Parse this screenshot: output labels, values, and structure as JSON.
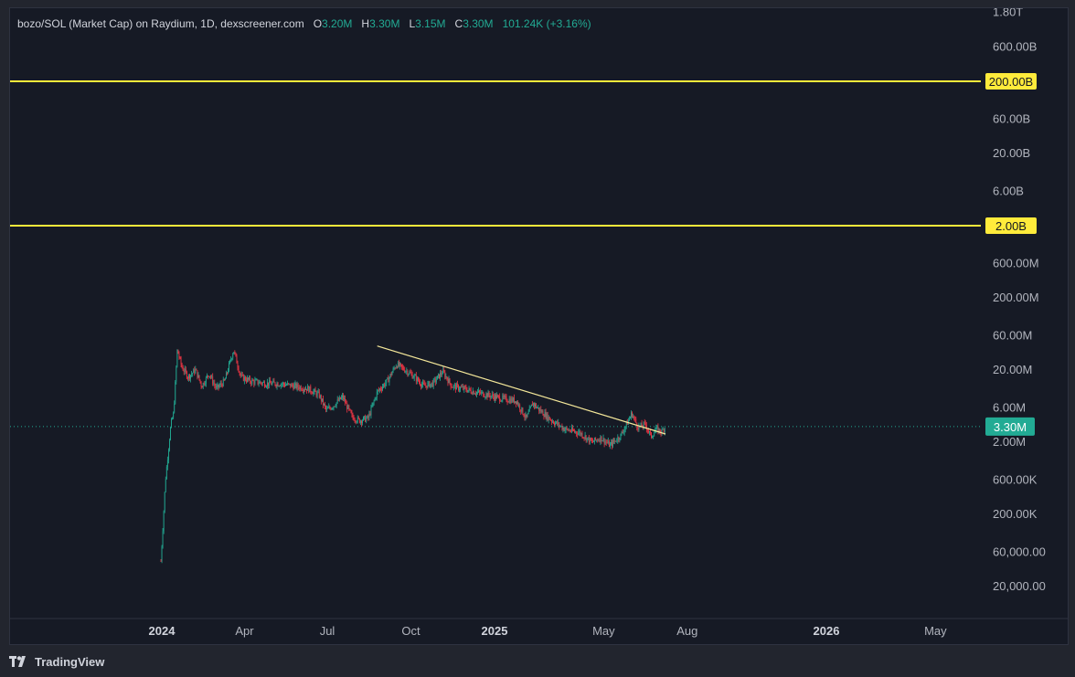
{
  "legend": {
    "title": "bozo/SOL (Market Cap) on Raydium, 1D, dexscreener.com",
    "o_label": "O",
    "o_value": "3.20M",
    "h_label": "H",
    "h_value": "3.30M",
    "l_label": "L",
    "l_value": "3.15M",
    "c_label": "C",
    "c_value": "3.30M",
    "change": "101.24K (+3.16%)"
  },
  "footer": {
    "brand": "TradingView",
    "logo_icon": "tradingview-logo-icon"
  },
  "colors": {
    "background": "#161a25",
    "up": "#22ab94",
    "down": "#f23645",
    "level_line": "#ffeb3b",
    "trendline": "#f5e89a",
    "axis_text": "#b2b5be"
  },
  "chart_data": {
    "type": "candlestick",
    "y_scale": "log",
    "y_ticks": [
      "1.80T",
      "600.00B",
      "60.00B",
      "20.00B",
      "6.00B",
      "600.00M",
      "200.00M",
      "60.00M",
      "20.00M",
      "6.00M",
      "2.00M",
      "600.00K",
      "200.00K",
      "60,000.00",
      "20,000.00"
    ],
    "y_tick_values": [
      1800000000000.0,
      600000000000.0,
      60000000000.0,
      20000000000.0,
      6000000000.0,
      600000000.0,
      200000000.0,
      60000000.0,
      20000000.0,
      6000000.0,
      2000000.0,
      600000.0,
      200000.0,
      60000.0,
      20000.0
    ],
    "x_ticks": [
      {
        "label": "2024",
        "date": "2024-01-01",
        "bold": true
      },
      {
        "label": "Apr",
        "date": "2024-04-01",
        "bold": false
      },
      {
        "label": "Jul",
        "date": "2024-07-01",
        "bold": false
      },
      {
        "label": "Oct",
        "date": "2024-10-01",
        "bold": false
      },
      {
        "label": "2025",
        "date": "2025-01-01",
        "bold": true
      },
      {
        "label": "May",
        "date": "2025-05-01",
        "bold": false
      },
      {
        "label": "Aug",
        "date": "2025-08-01",
        "bold": false
      },
      {
        "label": "2026",
        "date": "2026-01-01",
        "bold": true
      },
      {
        "label": "May",
        "date": "2026-05-01",
        "bold": false
      }
    ],
    "horizontal_levels": [
      {
        "value": 200000000000.0,
        "label": "200.00B"
      },
      {
        "value": 2000000000.0,
        "label": "2.00B"
      }
    ],
    "current_price": {
      "value": 3300000.0,
      "label": "3.30M"
    },
    "trendline": [
      {
        "date": "2024-08-25",
        "value": 43000000.0
      },
      {
        "date": "2025-07-08",
        "value": 2600000.0
      }
    ],
    "close_path": [
      [
        "2023-12-31",
        45000.0
      ],
      [
        "2024-01-02",
        120000.0
      ],
      [
        "2024-01-05",
        600000.0
      ],
      [
        "2024-01-08",
        1500000.0
      ],
      [
        "2024-01-11",
        3500000.0
      ],
      [
        "2024-01-14",
        5000000.0
      ],
      [
        "2024-01-18",
        38000000.0
      ],
      [
        "2024-01-23",
        22000000.0
      ],
      [
        "2024-01-30",
        16000000.0
      ],
      [
        "2024-02-07",
        20000000.0
      ],
      [
        "2024-02-14",
        12000000.0
      ],
      [
        "2024-02-22",
        18000000.0
      ],
      [
        "2024-03-01",
        11000000.0
      ],
      [
        "2024-03-10",
        14000000.0
      ],
      [
        "2024-03-20",
        38000000.0
      ],
      [
        "2024-03-28",
        16000000.0
      ],
      [
        "2024-04-08",
        14000000.0
      ],
      [
        "2024-04-25",
        13000000.0
      ],
      [
        "2024-05-10",
        13000000.0
      ],
      [
        "2024-05-25",
        12000000.0
      ],
      [
        "2024-06-10",
        11000000.0
      ],
      [
        "2024-06-22",
        9000000.0
      ],
      [
        "2024-06-30",
        5500000.0
      ],
      [
        "2024-07-08",
        6500000.0
      ],
      [
        "2024-07-18",
        8500000.0
      ],
      [
        "2024-07-28",
        4500000.0
      ],
      [
        "2024-08-05",
        4000000.0
      ],
      [
        "2024-08-15",
        4300000.0
      ],
      [
        "2024-08-25",
        10000000.0
      ],
      [
        "2024-09-05",
        14000000.0
      ],
      [
        "2024-09-15",
        24000000.0
      ],
      [
        "2024-09-25",
        20000000.0
      ],
      [
        "2024-10-05",
        16000000.0
      ],
      [
        "2024-10-15",
        12000000.0
      ],
      [
        "2024-10-25",
        13000000.0
      ],
      [
        "2024-11-05",
        19000000.0
      ],
      [
        "2024-11-15",
        12000000.0
      ],
      [
        "2024-11-28",
        11000000.0
      ],
      [
        "2024-12-10",
        10000000.0
      ],
      [
        "2024-12-25",
        9000000.0
      ],
      [
        "2025-01-10",
        8000000.0
      ],
      [
        "2025-01-25",
        7500000.0
      ],
      [
        "2025-02-05",
        4200000.0
      ],
      [
        "2025-02-12",
        7000000.0
      ],
      [
        "2025-02-20",
        5500000.0
      ],
      [
        "2025-03-05",
        4000000.0
      ],
      [
        "2025-03-20",
        3000000.0
      ],
      [
        "2025-04-05",
        2700000.0
      ],
      [
        "2025-04-18",
        2000000.0
      ],
      [
        "2025-04-28",
        2300000.0
      ],
      [
        "2025-05-08",
        1800000.0
      ],
      [
        "2025-05-20",
        2500000.0
      ],
      [
        "2025-06-01",
        5000000.0
      ],
      [
        "2025-06-08",
        3200000.0
      ],
      [
        "2025-06-16",
        3500000.0
      ],
      [
        "2025-06-22",
        2400000.0
      ],
      [
        "2025-06-28",
        3000000.0
      ],
      [
        "2025-07-04",
        2800000.0
      ],
      [
        "2025-07-08",
        3300000.0
      ]
    ]
  }
}
